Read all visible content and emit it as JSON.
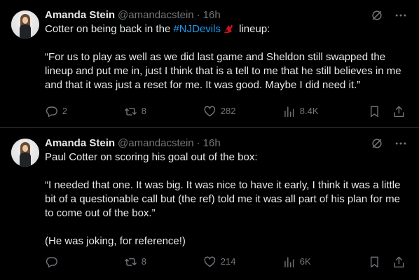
{
  "tweets": [
    {
      "author": {
        "name": "Amanda Stein",
        "handle": "@amandacstein",
        "time": "16h"
      },
      "text": {
        "lead": "Cotter on being back in the ",
        "hashtag": "#NJDevils",
        "trail": " lineup:",
        "quote": "“For us to play as well as we did last game and Sheldon still swapped the lineup and put me in, just I think that is a tell to me that he still believes in me and that it was just a reset for me. It was good. Maybe I did need it.”"
      },
      "actions": {
        "replies": "2",
        "retweets": "8",
        "likes": "282",
        "views": "8.4K"
      }
    },
    {
      "author": {
        "name": "Amanda Stein",
        "handle": "@amandacstein",
        "time": "16h"
      },
      "text": {
        "lead": "Paul Cotter on scoring his goal out of the box:",
        "quote": "“I needed that one. It was big. It was nice to have it early, I think it was a little bit of a questionable call but (the ref) told me it was all part of his plan for me to come out of the box.”",
        "note": "(He was joking, for reference!)"
      },
      "actions": {
        "replies": "",
        "retweets": "8",
        "likes": "214",
        "views": "6K"
      }
    }
  ],
  "dot": "·",
  "icons": {
    "avatar": "profile-photo",
    "grok": "grok-icon",
    "more": "more-icon",
    "reply": "reply-icon",
    "retweet": "retweet-icon",
    "like": "heart-icon",
    "views": "views-icon",
    "bookmark": "bookmark-icon",
    "share": "share-icon",
    "hashtag_emoji": "nj-devils-logo-icon"
  },
  "colors": {
    "background": "#000000",
    "text": "#e7e9ea",
    "muted": "#71767b",
    "link": "#1d9bf0",
    "divider": "#2f3336",
    "devils_red": "#ce1126"
  }
}
